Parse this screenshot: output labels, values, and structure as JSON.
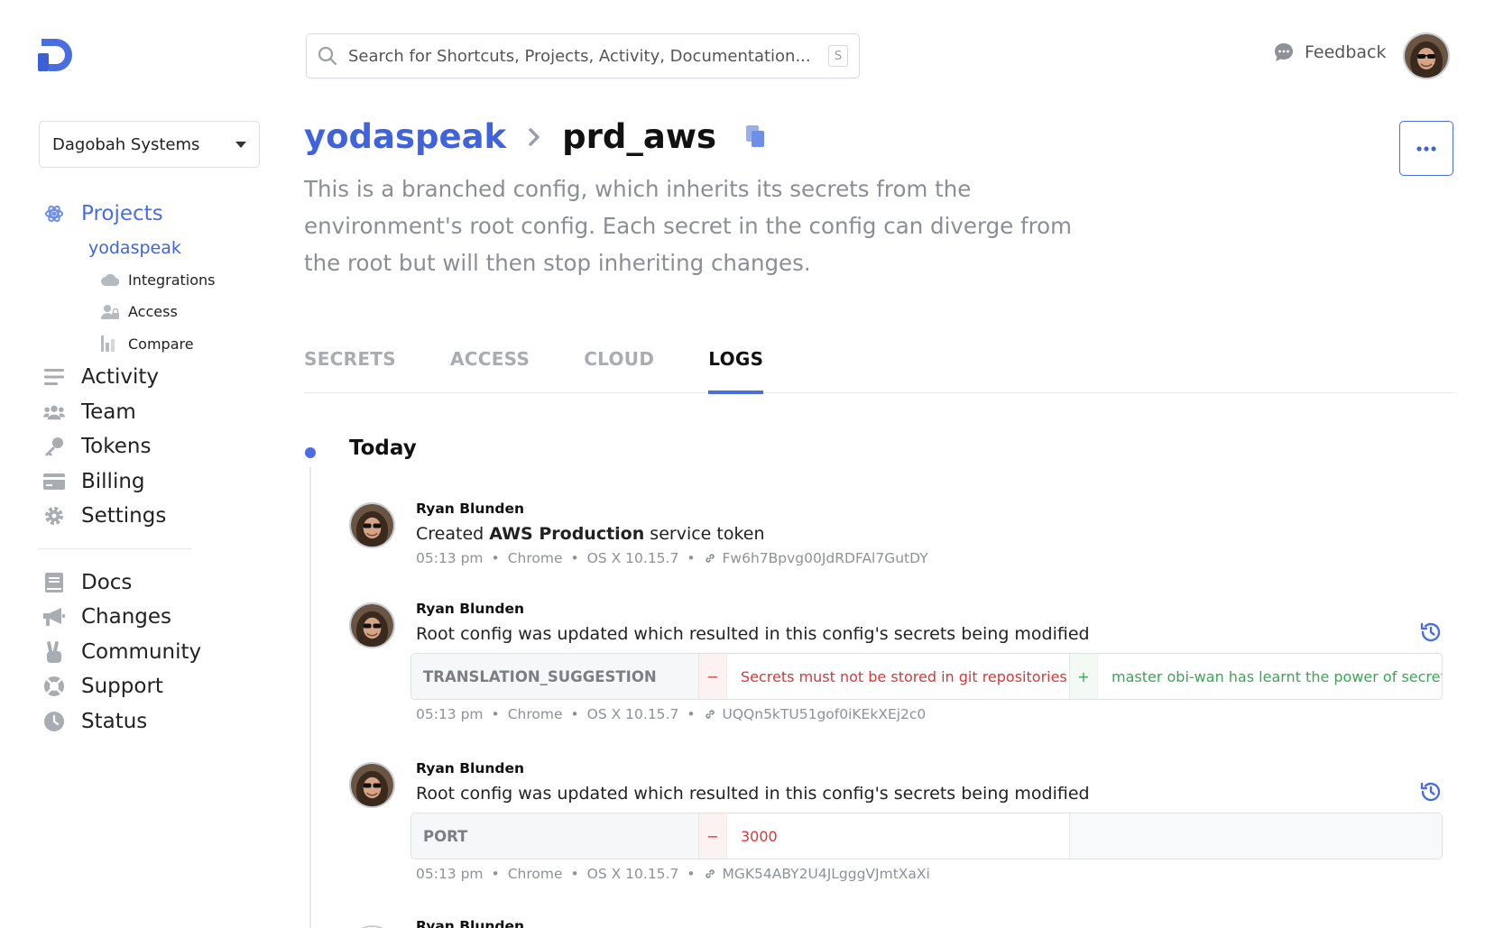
{
  "colors": {
    "accent": "#4a6ee0",
    "removed": "#d33a3a",
    "added": "#3aa655",
    "muted": "#8a8e95"
  },
  "org": {
    "name": "Dagobah Systems"
  },
  "search": {
    "placeholder": "Search for Shortcuts, Projects, Activity, Documentation...",
    "shortcut": "S"
  },
  "header": {
    "feedback_label": "Feedback"
  },
  "sidebar": {
    "projects_label": "Projects",
    "project_name": "yodaspeak",
    "sub_items": [
      {
        "label": "Integrations",
        "icon": "cloud-icon"
      },
      {
        "label": "Access",
        "icon": "user-lock-icon"
      },
      {
        "label": "Compare",
        "icon": "compare-icon"
      }
    ],
    "items": [
      {
        "label": "Activity",
        "icon": "list-icon"
      },
      {
        "label": "Team",
        "icon": "users-icon"
      },
      {
        "label": "Tokens",
        "icon": "key-icon"
      },
      {
        "label": "Billing",
        "icon": "credit-card-icon"
      },
      {
        "label": "Settings",
        "icon": "gear-icon"
      }
    ],
    "secondary_items": [
      {
        "label": "Docs",
        "icon": "book-icon"
      },
      {
        "label": "Changes",
        "icon": "megaphone-icon"
      },
      {
        "label": "Community",
        "icon": "peace-hand-icon"
      },
      {
        "label": "Support",
        "icon": "lifebuoy-icon"
      },
      {
        "label": "Status",
        "icon": "clock-icon"
      }
    ]
  },
  "breadcrumb": {
    "project": "yodaspeak",
    "config": "prd_aws"
  },
  "description": "This is a branched config, which inherits its secrets from the environment's root config. Each secret in the config can diverge from the root but will then stop inheriting changes.",
  "tabs": [
    {
      "label": "SECRETS",
      "active": false
    },
    {
      "label": "ACCESS",
      "active": false
    },
    {
      "label": "CLOUD",
      "active": false
    },
    {
      "label": "LOGS",
      "active": true
    }
  ],
  "timeline": {
    "day_label": "Today",
    "logs": [
      {
        "author": "Ryan Blunden",
        "message_pre": "Created ",
        "message_bold": "AWS Production",
        "message_post": " service token",
        "time": "05:13 pm",
        "browser": "Chrome",
        "os": "OS X 10.15.7",
        "log_id": "Fw6h7Bpvg00JdRDFAl7GutDY"
      },
      {
        "author": "Ryan Blunden",
        "message": "Root config was updated which resulted in this config's secrets being modified",
        "diff": {
          "key": "TRANSLATION_SUGGESTION",
          "removed_sign": "−",
          "old_value": "Secrets must not be stored in git repositories",
          "added_sign": "+",
          "new_value": "master obi-wan has learnt the power of secrets"
        },
        "time": "05:13 pm",
        "browser": "Chrome",
        "os": "OS X 10.15.7",
        "log_id": "UQQn5kTU51gof0iKEkXEj2c0"
      },
      {
        "author": "Ryan Blunden",
        "message": "Root config was updated which resulted in this config's secrets being modified",
        "diff": {
          "key": "PORT",
          "removed_sign": "−",
          "old_value": "3000"
        },
        "time": "05:13 pm",
        "browser": "Chrome",
        "os": "OS X 10.15.7",
        "log_id": "MGK54ABY2U4JLgggVJmtXaXi"
      },
      {
        "author": "Ryan Blunden"
      }
    ]
  }
}
